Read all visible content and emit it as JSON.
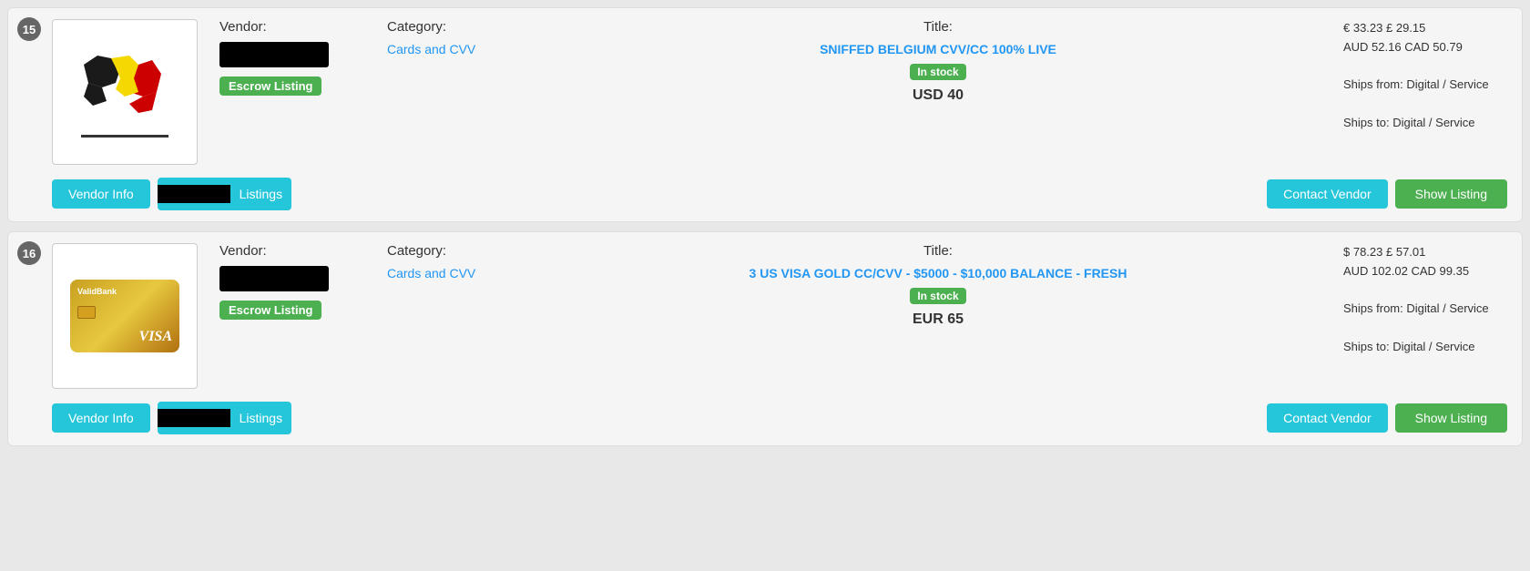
{
  "listings": [
    {
      "number": "15",
      "vendor_label": "Vendor:",
      "vendor_name_hidden": true,
      "escrow_label": "Escrow Listing",
      "category_label": "Category:",
      "category": "Cards and CVV",
      "title_label": "Title:",
      "title": "SNIFFED BELGIUM CVV/CC 100% LIVE",
      "in_stock": "In stock",
      "price_main": "USD 40",
      "price_eur": "€ 33.23",
      "price_gbp": "£ 29.15",
      "price_aud": "AUD 52.16",
      "price_cad": "CAD 50.79",
      "ships_from": "Ships from: Digital / Service",
      "ships_to": "Ships to: Digital / Service",
      "btn_vendor_info": "Vendor Info",
      "btn_listings": "Listings",
      "btn_contact": "Contact Vendor",
      "btn_show": "Show Listing",
      "image_type": "belgium_flag"
    },
    {
      "number": "16",
      "vendor_label": "Vendor:",
      "vendor_name_hidden": true,
      "escrow_label": "Escrow Listing",
      "category_label": "Category:",
      "category": "Cards and CVV",
      "title_label": "Title:",
      "title": "3 US VISA GOLD CC/CVV - $5000 - $10,000 BALANCE - FRESH",
      "in_stock": "In stock",
      "price_main": "EUR 65",
      "price_usd": "$ 78.23",
      "price_gbp": "£ 57.01",
      "price_aud": "AUD 102.02",
      "price_cad": "CAD 99.35",
      "ships_from": "Ships from: Digital / Service",
      "ships_to": "Ships to: Digital / Service",
      "btn_vendor_info": "Vendor Info",
      "btn_listings": "Listings",
      "btn_contact": "Contact Vendor",
      "btn_show": "Show Listing",
      "image_type": "visa_card"
    }
  ]
}
